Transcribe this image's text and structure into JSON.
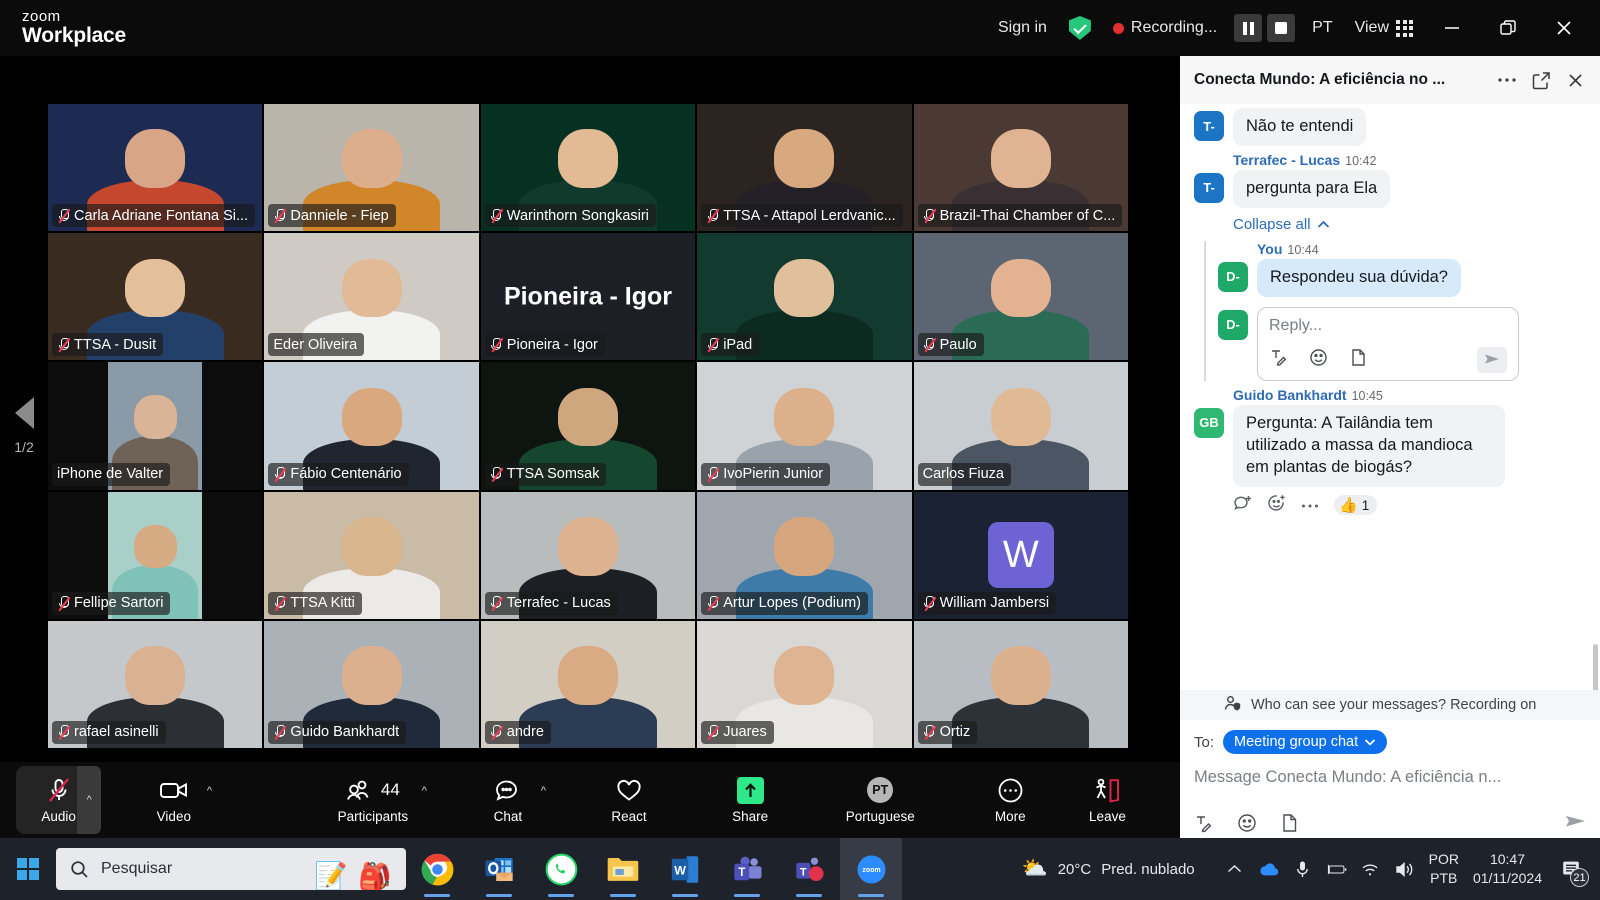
{
  "titlebar": {
    "logo_line1": "zoom",
    "logo_line2": "Workplace",
    "sign_in": "Sign in",
    "recording_label": "Recording...",
    "language_badge": "PT",
    "view_label": "View"
  },
  "stage": {
    "pager_left_label": "1/2",
    "pager_right_label": "1/2",
    "tiles": [
      {
        "name": "Carla Adriane Fontana Si...",
        "muted": true,
        "active": false,
        "kind": "video",
        "bg": "#1d2a52",
        "skin": "#d8a586",
        "shirt": "#c4472e"
      },
      {
        "name": "Danniele - Fiep",
        "muted": true,
        "active": false,
        "kind": "video",
        "bg": "#b9b5ab",
        "skin": "#dcae8c",
        "shirt": "#d2862a"
      },
      {
        "name": "Warinthorn Songkasiri",
        "muted": true,
        "active": false,
        "kind": "video",
        "bg": "#063021",
        "skin": "#e2bb94",
        "shirt": "#123a2c"
      },
      {
        "name": "TTSA - Attapol Lerdvanic...",
        "muted": true,
        "active": false,
        "kind": "video",
        "bg": "#2b2420",
        "skin": "#d8a97f",
        "shirt": "#232028"
      },
      {
        "name": "Brazil-Thai Chamber of C...",
        "muted": true,
        "active": false,
        "kind": "video",
        "bg": "#4a3a33",
        "skin": "#e0b493",
        "shirt": "#3a2f33"
      },
      {
        "name": "TTSA - Dusit",
        "muted": true,
        "active": false,
        "kind": "video",
        "bg": "#3a2b20",
        "skin": "#e3c09a",
        "shirt": "#23406b"
      },
      {
        "name": "Eder Oliveira",
        "muted": false,
        "active": true,
        "kind": "video",
        "bg": "#cfcac4",
        "skin": "#e1bb98",
        "shirt": "#f2f2f0"
      },
      {
        "name": "Pioneira - Igor",
        "muted": true,
        "active": false,
        "kind": "share",
        "share_title": "Pioneira - Igor",
        "bg": "#1c1f26"
      },
      {
        "name": "iPad",
        "muted": true,
        "active": false,
        "kind": "video",
        "bg": "#123a2e",
        "skin": "#e0c09c",
        "shirt": "#0d2a21"
      },
      {
        "name": "Paulo",
        "muted": true,
        "active": false,
        "kind": "video",
        "bg": "#5b6672",
        "skin": "#e3b391",
        "shirt": "#2b6a54"
      },
      {
        "name": "iPhone de Valter",
        "muted": false,
        "active": false,
        "kind": "portrait",
        "bg": "#0c0c0c",
        "skin": "#d9b496",
        "shirt": "#6f6257",
        "inner": "#8a9aa6"
      },
      {
        "name": "Fábio Centenário",
        "muted": true,
        "active": false,
        "kind": "video",
        "bg": "#c3cdd5",
        "skin": "#d9a87f",
        "shirt": "#20262f"
      },
      {
        "name": "TTSA Somsak",
        "muted": true,
        "active": false,
        "kind": "video",
        "bg": "#0e1410",
        "skin": "#cfa77f",
        "shirt": "#15472f"
      },
      {
        "name": "IvoPierin Junior",
        "muted": true,
        "active": false,
        "kind": "video",
        "bg": "#cfd3d6",
        "skin": "#dcb08a",
        "shirt": "#9aa2ab"
      },
      {
        "name": "Carlos Fiuza",
        "muted": false,
        "active": false,
        "kind": "video",
        "bg": "#c8cdd2",
        "skin": "#e0b995",
        "shirt": "#4b5563"
      },
      {
        "name": "Fellipe Sartori",
        "muted": true,
        "active": false,
        "kind": "portrait",
        "bg": "#0c0c0c",
        "skin": "#d6ab84",
        "shirt": "#7fc2b8",
        "inner": "#a9cfc9"
      },
      {
        "name": "TTSA Kitti",
        "muted": true,
        "active": false,
        "kind": "video",
        "bg": "#c9bba6",
        "skin": "#d9b68e",
        "shirt": "#eceae6"
      },
      {
        "name": "Terrafec - Lucas",
        "muted": true,
        "active": false,
        "kind": "video",
        "bg": "#b9bcbd",
        "skin": "#dcb291",
        "shirt": "#1c1f24"
      },
      {
        "name": "Artur Lopes (Podium)",
        "muted": true,
        "active": false,
        "kind": "video",
        "bg": "#9fa6ad",
        "skin": "#d6a77e",
        "shirt": "#3f7ba8"
      },
      {
        "name": "William Jambersi",
        "muted": true,
        "active": false,
        "kind": "initials",
        "initials": "W",
        "bg": "#1b2233",
        "avatar_color": "#6d63d4"
      },
      {
        "name": "rafael asinelli",
        "muted": true,
        "active": false,
        "kind": "video",
        "bg": "#c4c8cb",
        "skin": "#d9b293",
        "shirt": "#2c2f33"
      },
      {
        "name": "Guido Bankhardt",
        "muted": true,
        "active": false,
        "kind": "video",
        "bg": "#aab2b8",
        "skin": "#dcb08f",
        "shirt": "#1f2a3a"
      },
      {
        "name": "andre",
        "muted": true,
        "active": false,
        "kind": "video",
        "bg": "#d2cec4",
        "skin": "#d9ab84",
        "shirt": "#2b3c55"
      },
      {
        "name": "Juares",
        "muted": true,
        "active": false,
        "kind": "video",
        "bg": "#d9d8d4",
        "skin": "#deb492",
        "shirt": "#e8e7e3"
      },
      {
        "name": "Ortiz",
        "muted": true,
        "active": false,
        "kind": "video",
        "bg": "#b7bdc2",
        "skin": "#dbb18d",
        "shirt": "#2d3239"
      }
    ]
  },
  "toolbar": {
    "audio_label": "Audio",
    "video_label": "Video",
    "participants_label": "Participants",
    "participants_count": "44",
    "chat_label": "Chat",
    "react_label": "React",
    "share_label": "Share",
    "language_label": "Portuguese",
    "language_badge": "PT",
    "more_label": "More",
    "leave_label": "Leave"
  },
  "chat": {
    "title": "Conecta Mundo: A eficiência no ...",
    "messages": [
      {
        "id": "m1",
        "avatar_initials": "T-",
        "avatar_color": "#1b74c4",
        "text": "Não te entendi",
        "show_sender": false
      },
      {
        "id": "m2",
        "sender": "Terrafec - Lucas",
        "time": "10:42",
        "avatar_initials": "T-",
        "avatar_color": "#1b74c4",
        "text": "pergunta para Ela",
        "show_sender": true
      }
    ],
    "collapse_label": "Collapse all",
    "thread": {
      "sender": "You",
      "time": "10:44",
      "avatar_initials": "D-",
      "avatar_color": "#1fa968",
      "text": "Respondeu sua dúvida?",
      "reply_placeholder": "Reply...",
      "reply_avatar_initials": "D-"
    },
    "question": {
      "sender": "Guido Bankhardt",
      "time": "10:45",
      "avatar_initials": "GB",
      "avatar_color": "#2eb872",
      "text": "Pergunta: A Tailândia tem utilizado a massa da mandioca em plantas de biogás?",
      "reaction_emoji": "👍",
      "reaction_count": "1"
    },
    "privacy_note": "Who can see your messages? Recording on",
    "to_label": "To:",
    "to_value": "Meeting group chat",
    "message_placeholder": "Message Conecta Mundo: A eficiência n..."
  },
  "taskbar": {
    "search_placeholder": "Pesquisar",
    "weather_temp": "20°C",
    "weather_desc": "Pred. nublado",
    "lang_line1": "POR",
    "lang_line2": "PTB",
    "time": "10:47",
    "date": "01/11/2024",
    "notification_count": "21",
    "apps": [
      "chrome",
      "outlook",
      "whatsapp",
      "explorer",
      "word",
      "teams",
      "teams-alt",
      "zoom"
    ]
  },
  "colors": {
    "accent_blue": "#0e71eb",
    "active_speaker_green": "#37d67a",
    "mute_red": "#ef3b55",
    "share_green": "#2ee88a"
  }
}
